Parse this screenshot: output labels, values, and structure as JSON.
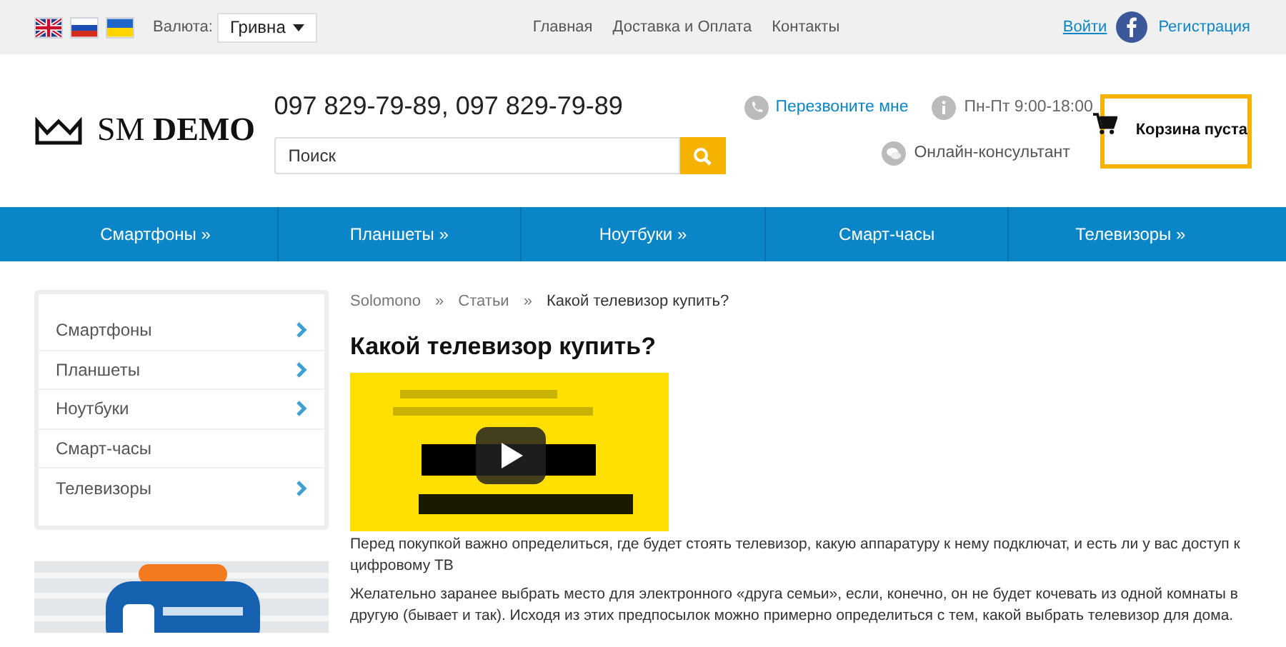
{
  "top_bar": {
    "languages": [
      {
        "kind": "uk",
        "selected": false
      },
      {
        "kind": "ru",
        "selected": false
      },
      {
        "kind": "ua",
        "selected": false
      }
    ],
    "currency_label": "Валюта:",
    "currency_value": "Гривна",
    "links": [
      "Главная",
      "Доставка и Оплата",
      "Контакты"
    ],
    "login": "Войти",
    "register": "Регистрация"
  },
  "header": {
    "logo_light": "SM",
    "logo_bold": "DEMO",
    "phones": "097 829-79-89, 097 829-79-89",
    "callback": "Перезвоните мне",
    "hours": "Пн-Пт 9:00-18:00",
    "consultant": "Онлайн-консультант",
    "search": {
      "placeholder": "Поиск"
    },
    "cart": "Корзина пуста"
  },
  "nav": [
    {
      "label": "Смартфоны »"
    },
    {
      "label": "Планшеты »"
    },
    {
      "label": "Ноутбуки »"
    },
    {
      "label": "Смарт-часы"
    },
    {
      "label": "Телевизоры »"
    }
  ],
  "sidebar": {
    "items": [
      {
        "label": "Смартфоны",
        "has_children": true
      },
      {
        "label": "Планшеты",
        "has_children": true
      },
      {
        "label": "Ноутбуки",
        "has_children": true
      },
      {
        "label": "Смарт-часы",
        "has_children": false
      },
      {
        "label": "Телевизоры",
        "has_children": true
      }
    ]
  },
  "breadcrumbs": [
    {
      "label": "Solomono"
    },
    {
      "separator": "»",
      "label": "Статьи"
    },
    {
      "separator": "»",
      "label": "Какой телевизор купить?"
    }
  ],
  "article": {
    "title": "Какой телевизор купить?",
    "paragraphs": [
      "Перед покупкой важно определиться, где будет стоять телевизор, какую аппаратуру к нему подключат, и есть ли у вас доступ к цифровому ТВ",
      "Желательно заранее выбрать место для электронного «друга семьи», если, конечно, он не будет кочевать из одной комнаты в другую (бывает и так). Исходя из этих предпосылок можно примерно определиться с тем, какой выбрать телевизор для дома."
    ]
  }
}
